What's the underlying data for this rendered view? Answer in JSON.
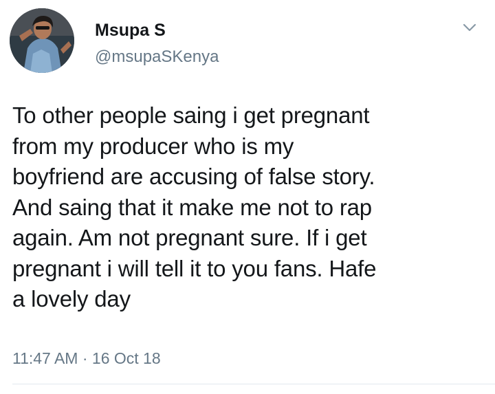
{
  "author": {
    "display_name": "Msupa S",
    "handle": "@msupaSKenya",
    "avatar": "user-avatar-photo"
  },
  "menu": {
    "icon": "chevron-down-icon"
  },
  "tweet": {
    "lines": [
      "To other people saing i get pregnant",
      "from my producer who is my",
      "boyfriend are accusing of false story.",
      "And saing that it make me not to rap",
      "again. Am not pregnant sure. If i get",
      "pregnant i will tell it to you fans. Hafe",
      "a lovely day"
    ]
  },
  "meta": {
    "timestamp": "11:47 AM · 16 Oct 18"
  },
  "colors": {
    "text": "#14171a",
    "secondary": "#657786",
    "divider": "#e1e8ed"
  }
}
